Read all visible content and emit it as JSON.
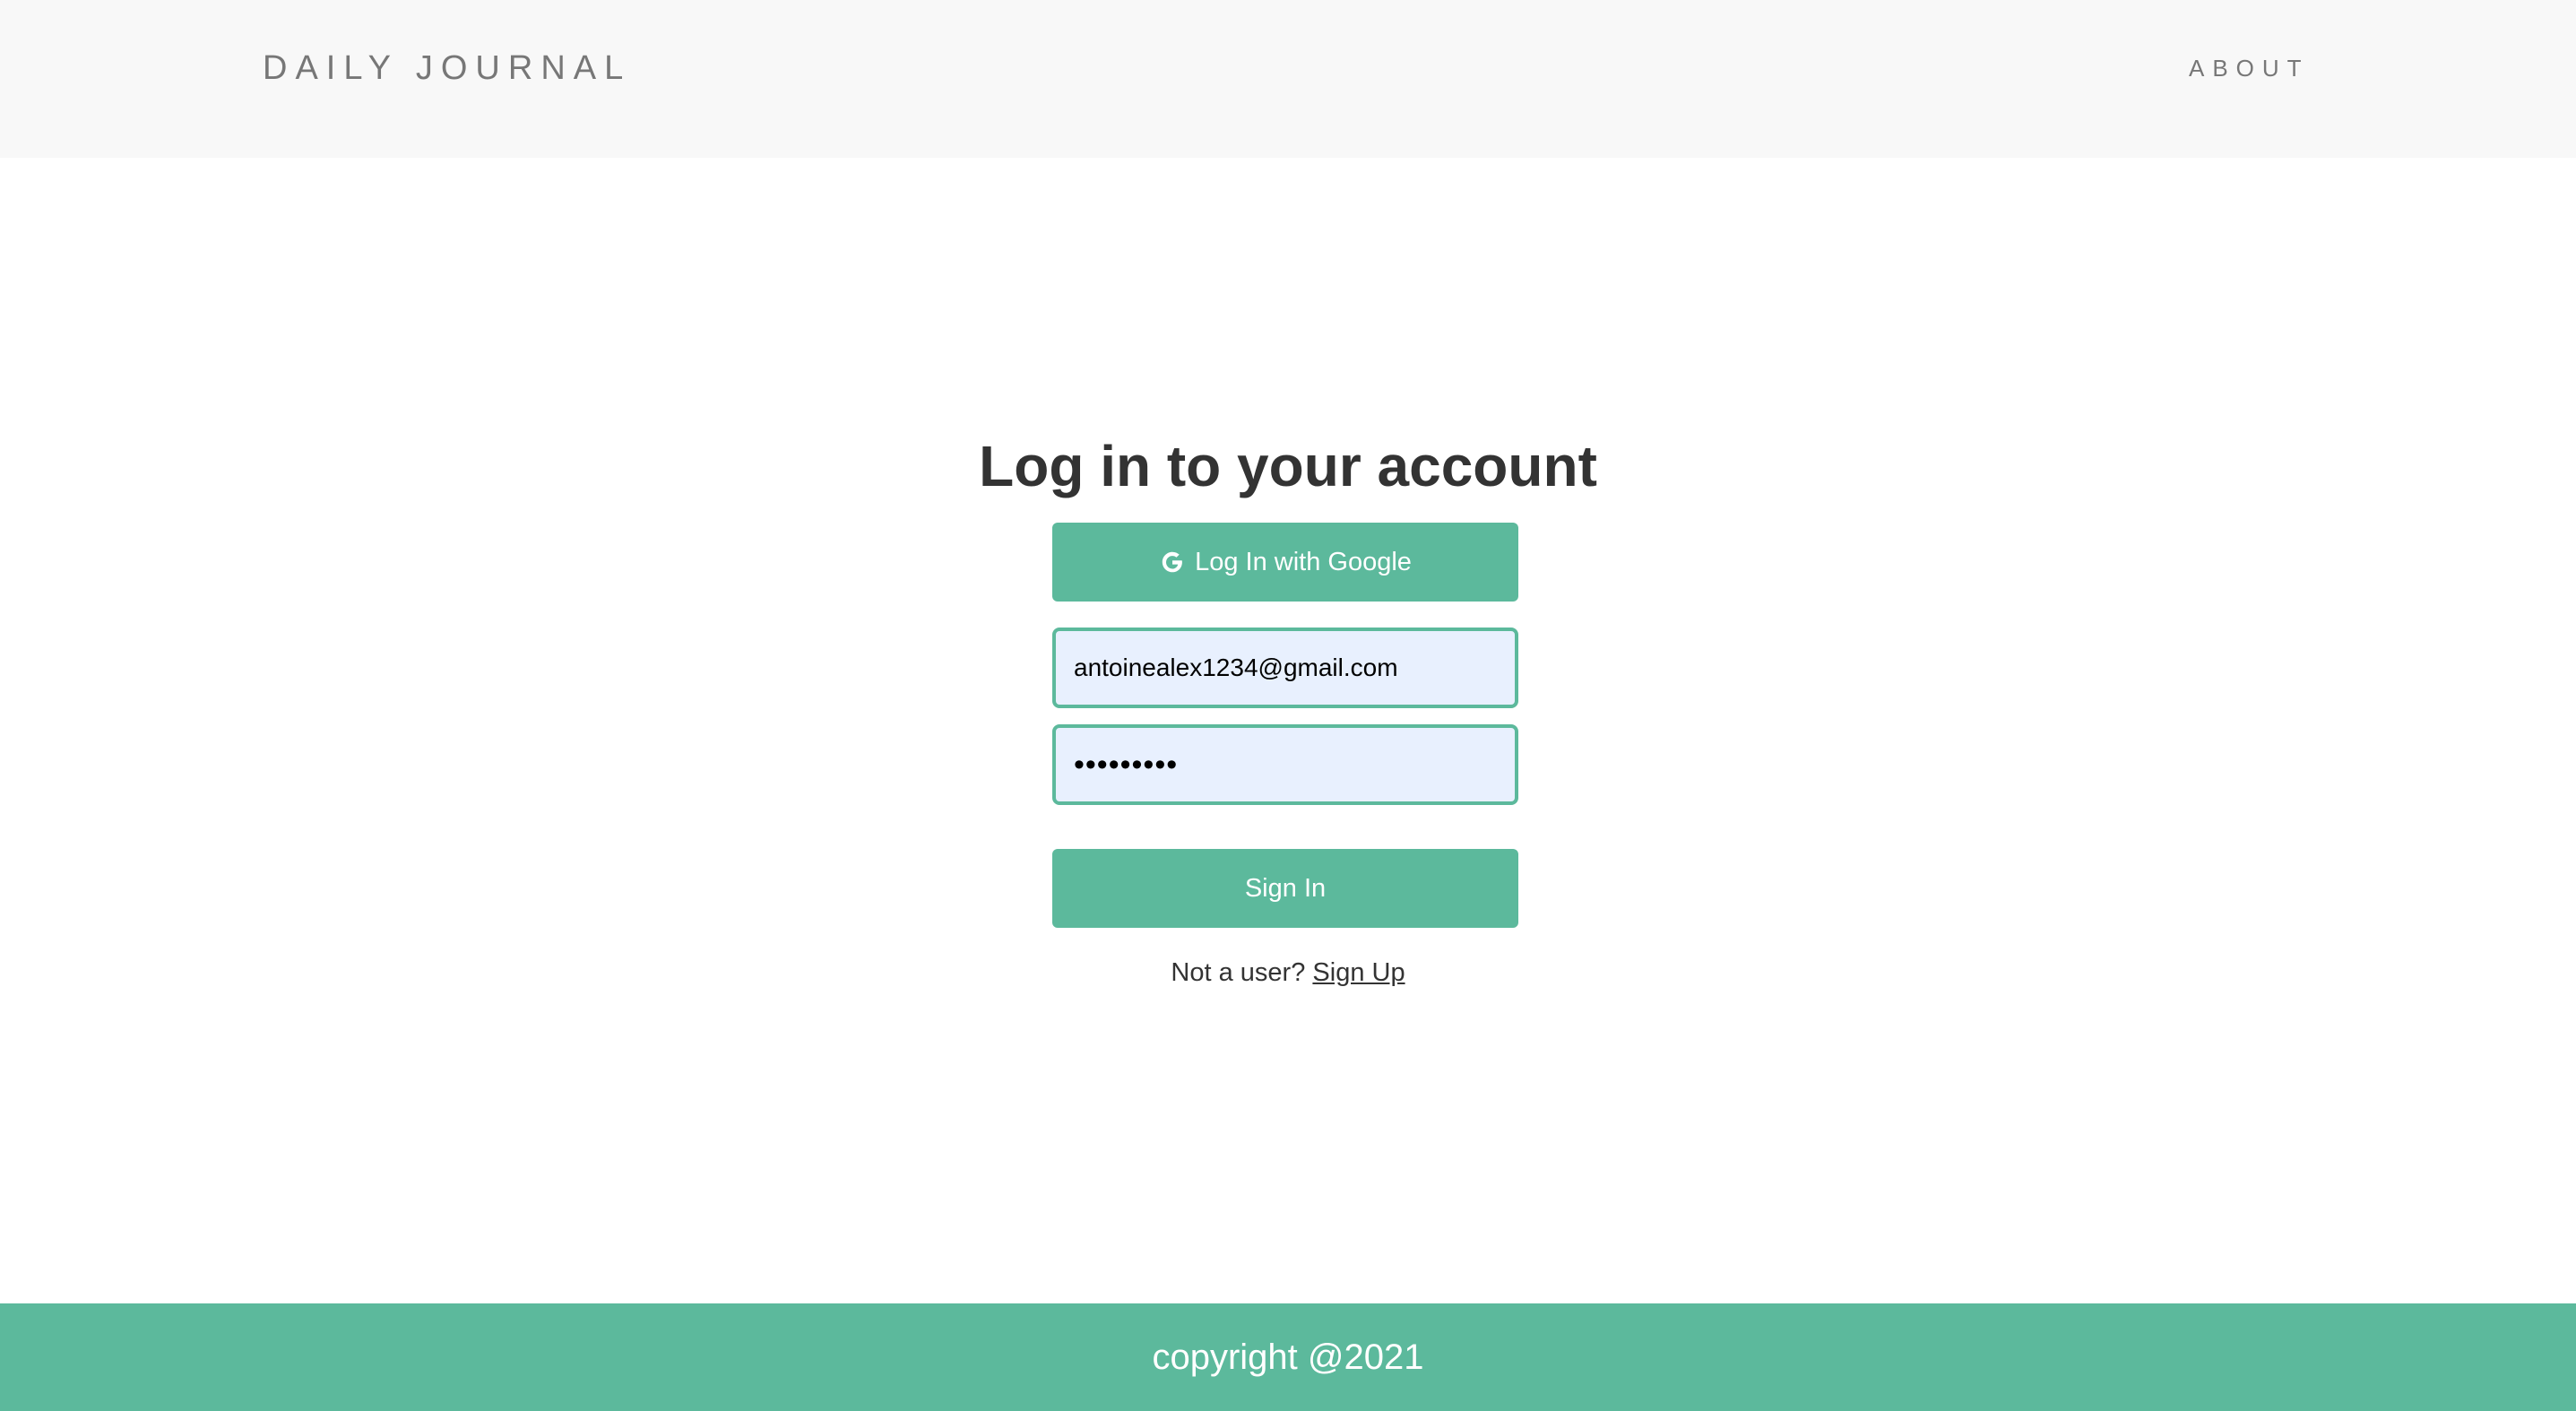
{
  "header": {
    "brand": "DAILY JOURNAL",
    "nav_about": "ABOUT"
  },
  "login": {
    "heading": "Log in to your account",
    "google_button_label": "Log In with Google",
    "google_icon": "google-icon",
    "email_value": "antoinealex1234@gmail.com",
    "password_value": "•••••••••",
    "signin_label": "Sign In",
    "signup_prompt": "Not a user?",
    "signup_link": "Sign Up"
  },
  "footer": {
    "copyright": "copyright @2021"
  },
  "colors": {
    "accent": "#5cb99c",
    "header_bg": "#f8f8f8",
    "input_bg": "#e8f0fe",
    "text_dark": "#333333",
    "text_muted": "#777777"
  }
}
